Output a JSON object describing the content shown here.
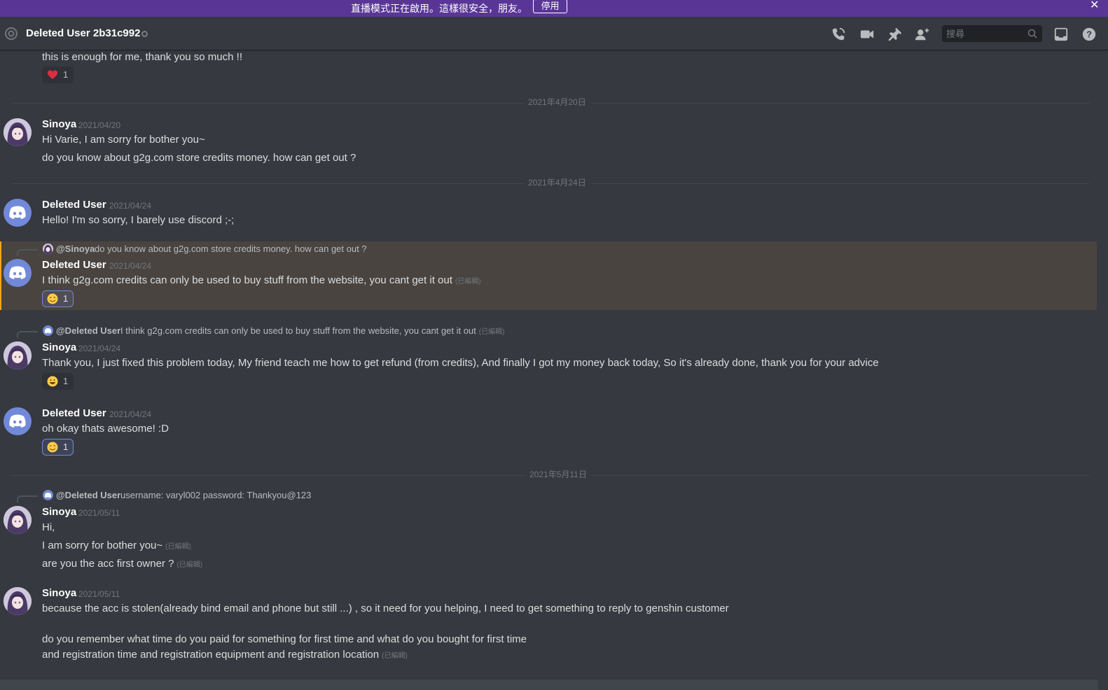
{
  "banner": {
    "text": "直播模式正在啟用。這樣很安全，朋友。",
    "button_label": "停用",
    "close_glyph": "✕"
  },
  "header": {
    "title": "Deleted User 2b31c992",
    "search_placeholder": "搜尋",
    "icons": [
      "at-icon",
      "status-offline-icon",
      "voice-call-icon",
      "video-call-icon",
      "pinned-icon",
      "add-friend-icon",
      "search-icon",
      "inbox-icon",
      "help-icon"
    ]
  },
  "colors": {
    "banner": "#593695",
    "background": "#36393f",
    "highlight": "#494440",
    "highlight_border": "#faa61a",
    "blurple": "#7289da"
  },
  "messages": {
    "m0": {
      "text": "this is enough for me, thank you so much !!",
      "reaction_count": "1",
      "reaction_emoji": "heart"
    },
    "d1": "2021年4月20日",
    "m1": {
      "author": "Sinoya",
      "timestamp": "2021/04/20",
      "line1": "Hi Varie, I am sorry for bother you~",
      "line2": "do you know about g2g.com store credits money. how can get out ?"
    },
    "d2": "2021年4月24日",
    "m2": {
      "author": "Deleted User",
      "timestamp": "2021/04/24",
      "text": "Hello! I'm so sorry, I barely use discord ;-;"
    },
    "m3": {
      "reply_name": "@Sinoya",
      "reply_text": "do you know about g2g.com store credits money. how can get out ?",
      "author": "Deleted User",
      "timestamp": "2021/04/24",
      "text": "I think g2g.com credits can only be used to buy stuff from the website, you cant get it out",
      "edited": "(已編輯)",
      "reaction_count": "1",
      "reaction_emoji": "blush"
    },
    "m4": {
      "reply_name": "@Deleted User",
      "reply_text": "I think g2g.com credits can only be used to buy stuff from the website, you cant get it out",
      "reply_edited": "(已編輯)",
      "author": "Sinoya",
      "timestamp": "2021/04/24",
      "text": "Thank you, I just fixed this problem today, My friend teach me how to get refund (from credits), And finally I got my money back today, So it's already done, thank you for your advice",
      "reaction_count": "1",
      "reaction_emoji": "smile"
    },
    "m5": {
      "author": "Deleted User",
      "timestamp": "2021/04/24",
      "text": "oh okay thats awesome! :D",
      "reaction_count": "1",
      "reaction_emoji": "blush"
    },
    "d3": "2021年5月11日",
    "m6": {
      "reply_name": "@Deleted User",
      "reply_text": "username: varyl002 password: Thankyou@123",
      "author": "Sinoya",
      "timestamp": "2021/05/11",
      "line1": "Hi,",
      "line2": "I am sorry for bother you~",
      "line3": "are you the acc first owner ?",
      "edited": "(已編輯)"
    },
    "m7": {
      "author": "Sinoya",
      "timestamp": "2021/05/11",
      "line1": "because the acc is stolen(already bind email and phone but still ...) , so it need for you helping, I need to get something to reply to genshin customer",
      "line2": "do you remember what time do you paid for something for first time and what do you bought for first time",
      "line3": "and registration time and registration equipment and registration location",
      "edited": "(已編輯)"
    }
  }
}
